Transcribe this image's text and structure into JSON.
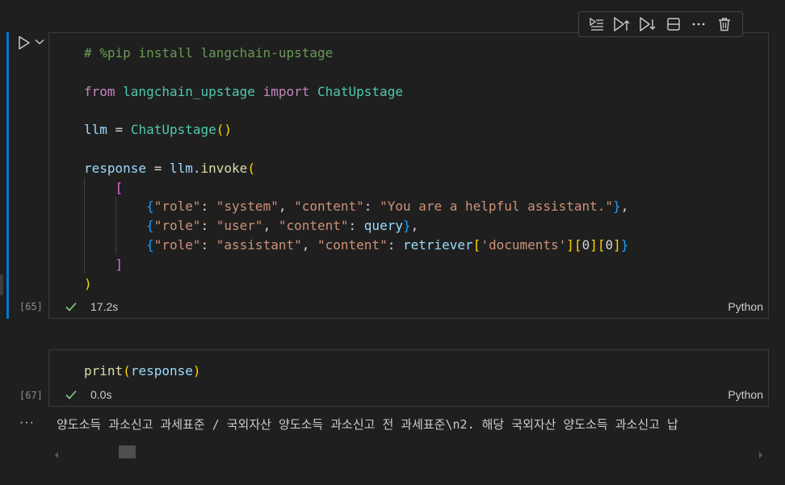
{
  "toolbar": {
    "icons": [
      "execute-above-icon",
      "run-above-icon",
      "run-below-icon",
      "split-cell-icon",
      "more-icon",
      "delete-icon"
    ]
  },
  "cell1": {
    "code_lines": [
      [
        {
          "t": "# %pip install langchain-upstage",
          "c": "cm"
        }
      ],
      [],
      [
        {
          "t": "from",
          "c": "kw"
        },
        {
          "t": " langchain_upstage ",
          "c": "cls"
        },
        {
          "t": "import",
          "c": "kw"
        },
        {
          "t": " ChatUpstage",
          "c": "cls"
        }
      ],
      [],
      [
        {
          "t": "llm",
          "c": "var"
        },
        {
          "t": " = ",
          "c": "pl"
        },
        {
          "t": "ChatUpstage",
          "c": "cls"
        },
        {
          "t": "()",
          "c": "br1"
        }
      ],
      [],
      [
        {
          "t": "response",
          "c": "var"
        },
        {
          "t": " = ",
          "c": "pl"
        },
        {
          "t": "llm",
          "c": "var"
        },
        {
          "t": ".",
          "c": "pl"
        },
        {
          "t": "invoke",
          "c": "fn"
        },
        {
          "t": "(",
          "c": "br1"
        }
      ],
      [
        {
          "t": "    ",
          "c": "pl"
        },
        {
          "t": "[",
          "c": "br2"
        }
      ],
      [
        {
          "t": "        ",
          "c": "pl"
        },
        {
          "t": "{",
          "c": "br3"
        },
        {
          "t": "\"role\"",
          "c": "str"
        },
        {
          "t": ": ",
          "c": "pl"
        },
        {
          "t": "\"system\"",
          "c": "str"
        },
        {
          "t": ", ",
          "c": "pl"
        },
        {
          "t": "\"content\"",
          "c": "str"
        },
        {
          "t": ": ",
          "c": "pl"
        },
        {
          "t": "\"You are a helpful assistant.\"",
          "c": "str"
        },
        {
          "t": "}",
          "c": "br3"
        },
        {
          "t": ",",
          "c": "pl"
        }
      ],
      [
        {
          "t": "        ",
          "c": "pl"
        },
        {
          "t": "{",
          "c": "br3"
        },
        {
          "t": "\"role\"",
          "c": "str"
        },
        {
          "t": ": ",
          "c": "pl"
        },
        {
          "t": "\"user\"",
          "c": "str"
        },
        {
          "t": ", ",
          "c": "pl"
        },
        {
          "t": "\"content\"",
          "c": "str"
        },
        {
          "t": ": ",
          "c": "pl"
        },
        {
          "t": "query",
          "c": "var"
        },
        {
          "t": "}",
          "c": "br3"
        },
        {
          "t": ",",
          "c": "pl"
        }
      ],
      [
        {
          "t": "        ",
          "c": "pl"
        },
        {
          "t": "{",
          "c": "br3"
        },
        {
          "t": "\"role\"",
          "c": "str"
        },
        {
          "t": ": ",
          "c": "pl"
        },
        {
          "t": "\"assistant\"",
          "c": "str"
        },
        {
          "t": ", ",
          "c": "pl"
        },
        {
          "t": "\"content\"",
          "c": "str"
        },
        {
          "t": ": ",
          "c": "pl"
        },
        {
          "t": "retriever",
          "c": "var"
        },
        {
          "t": "[",
          "c": "br1"
        },
        {
          "t": "'documents'",
          "c": "str"
        },
        {
          "t": "]",
          "c": "br1"
        },
        {
          "t": "[",
          "c": "br1"
        },
        {
          "t": "0",
          "c": "pl"
        },
        {
          "t": "]",
          "c": "br1"
        },
        {
          "t": "[",
          "c": "br1"
        },
        {
          "t": "0",
          "c": "pl"
        },
        {
          "t": "]",
          "c": "br1"
        },
        {
          "t": "}",
          "c": "br3"
        }
      ],
      [
        {
          "t": "    ",
          "c": "pl"
        },
        {
          "t": "]",
          "c": "br2"
        }
      ],
      [
        {
          "t": ")",
          "c": "br1"
        }
      ]
    ],
    "exec_count": "[65]",
    "time": "17.2s",
    "language": "Python"
  },
  "cell2": {
    "code_lines": [
      [
        {
          "t": "print",
          "c": "fn"
        },
        {
          "t": "(",
          "c": "br1"
        },
        {
          "t": "response",
          "c": "var"
        },
        {
          "t": ")",
          "c": "br1"
        }
      ]
    ],
    "exec_count": "[67]",
    "time": "0.0s",
    "language": "Python"
  },
  "output": {
    "ellipsis": "···",
    "text": "양도소득 과소신고 과세표준 / 국외자산 양도소득 과소신고 전 과세표준\\n2. 해당 국외자산 양도소득 과소신고 납"
  },
  "colors": {
    "accent": "#0078d4",
    "success": "#89d185",
    "background": "#1f1f1f"
  }
}
